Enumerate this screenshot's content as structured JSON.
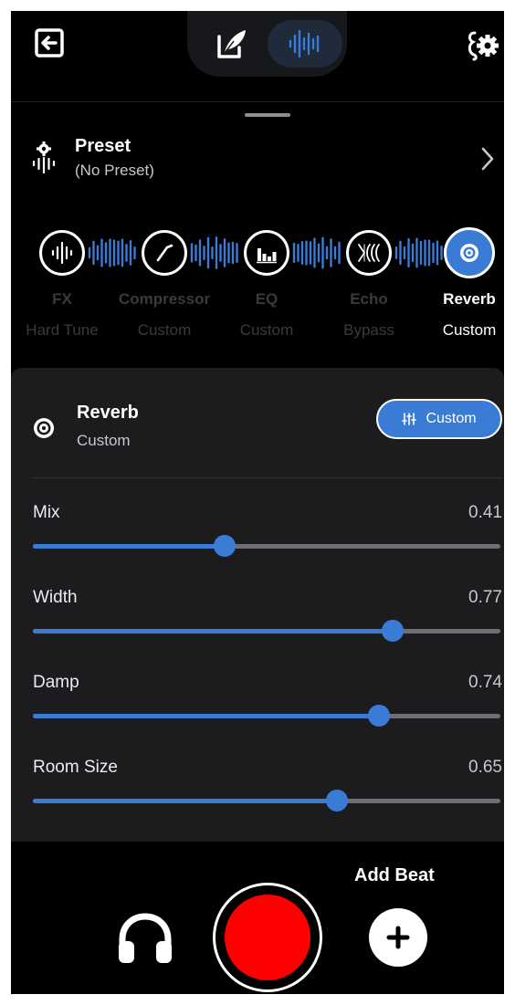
{
  "preset": {
    "title": "Preset",
    "subtitle": "(No Preset)"
  },
  "effects": [
    {
      "name": "FX",
      "state": "Hard Tune",
      "icon": "waveform-icon",
      "active": false
    },
    {
      "name": "Compressor",
      "state": "Custom",
      "icon": "compressor-curve-icon",
      "active": false
    },
    {
      "name": "EQ",
      "state": "Custom",
      "icon": "eq-bars-icon",
      "active": false
    },
    {
      "name": "Echo",
      "state": "Bypass",
      "icon": "echo-icon",
      "active": false
    },
    {
      "name": "Reverb",
      "state": "Custom",
      "icon": "reverb-icon",
      "active": true
    }
  ],
  "panel": {
    "title": "Reverb",
    "subtitle": "Custom",
    "mode_button_label": "Custom",
    "params": [
      {
        "label": "Mix",
        "value": "0.41",
        "level": 0.41
      },
      {
        "label": "Width",
        "value": "0.77",
        "level": 0.77
      },
      {
        "label": "Damp",
        "value": "0.74",
        "level": 0.74
      },
      {
        "label": "Room Size",
        "value": "0.65",
        "level": 0.65
      }
    ]
  },
  "bottom": {
    "add_beat_label": "Add Beat"
  },
  "colors": {
    "accent": "#3a7bd5",
    "record": "#ff0000",
    "track": "#6e6e73",
    "panel_bg": "#1c1c1e"
  }
}
